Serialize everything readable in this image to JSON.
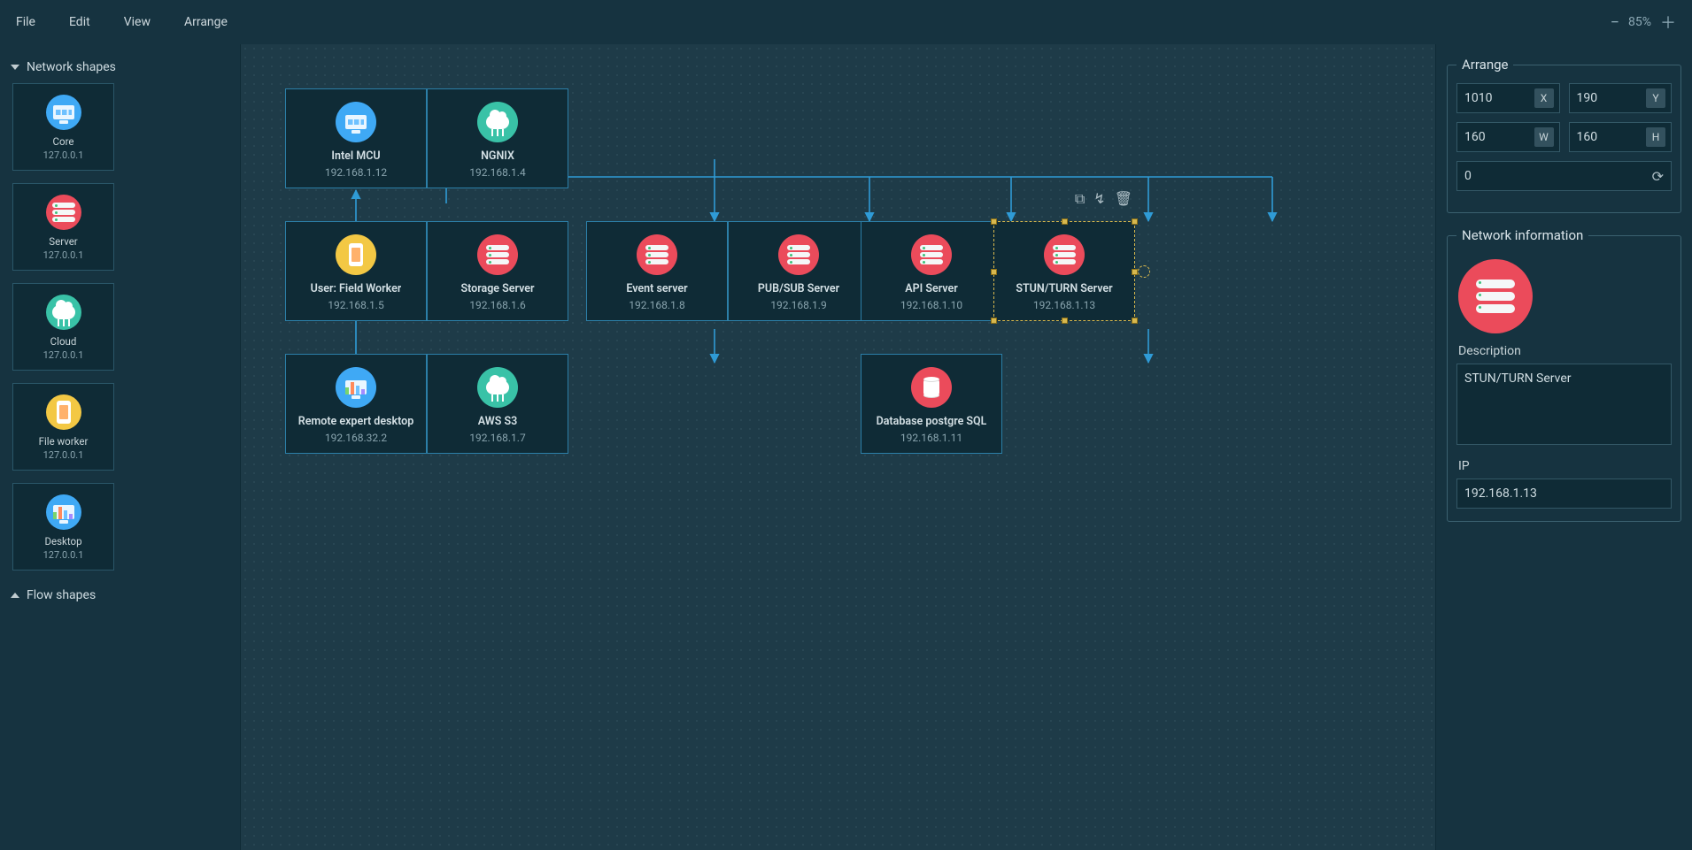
{
  "menu": {
    "file": "File",
    "edit": "Edit",
    "view": "View",
    "arrange": "Arrange",
    "zoom": "85%"
  },
  "left": {
    "section_network": "Network shapes",
    "section_flow": "Flow shapes",
    "shapes": [
      {
        "label": "Core",
        "ip": "127.0.0.1",
        "icon": "core"
      },
      {
        "label": "Server",
        "ip": "127.0.0.1",
        "icon": "server"
      },
      {
        "label": "Cloud",
        "ip": "127.0.0.1",
        "icon": "cloud"
      },
      {
        "label": "File worker",
        "ip": "127.0.0.1",
        "icon": "fileworker"
      },
      {
        "label": "Desktop",
        "ip": "127.0.0.1",
        "icon": "desktop"
      }
    ]
  },
  "canvas": {
    "nodes": {
      "intel": {
        "label": "Intel MCU",
        "ip": "192.168.1.12"
      },
      "nginx": {
        "label": "NGNIX",
        "ip": "192.168.1.4"
      },
      "user": {
        "label": "User: Field Worker",
        "ip": "192.168.1.5"
      },
      "storage": {
        "label": "Storage Server",
        "ip": "192.168.1.6"
      },
      "event": {
        "label": "Event server",
        "ip": "192.168.1.8"
      },
      "pubsub": {
        "label": "PUB/SUB Server",
        "ip": "192.168.1.9"
      },
      "api": {
        "label": "API Server",
        "ip": "192.168.1.10"
      },
      "stun": {
        "label": "STUN/TURN Server",
        "ip": "192.168.1.13"
      },
      "remote": {
        "label": "Remote expert desktop",
        "ip": "192.168.32.2"
      },
      "s3": {
        "label": "AWS S3",
        "ip": "192.168.1.7"
      },
      "db": {
        "label": "Database postgre SQL",
        "ip": "192.168.1.11"
      }
    }
  },
  "right": {
    "arrange_legend": "Arrange",
    "x": "1010",
    "y": "190",
    "w": "160",
    "h": "160",
    "rot": "0",
    "x_label": "X",
    "y_label": "Y",
    "w_label": "W",
    "h_label": "H",
    "info_legend": "Network information",
    "desc_label": "Description",
    "desc_value": "STUN/TURN Server",
    "ip_label": "IP",
    "ip_value": "192.168.1.13"
  }
}
